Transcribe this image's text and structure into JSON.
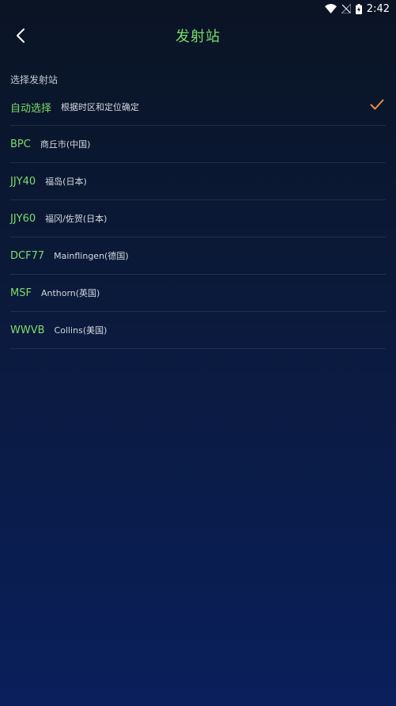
{
  "status_bar": {
    "time": "2:42"
  },
  "header": {
    "title": "发射站"
  },
  "section_label": "选择发射站",
  "stations": [
    {
      "code": "自动选择",
      "desc": "根据时区和定位确定",
      "selected": true
    },
    {
      "code": "BPC",
      "desc": "商丘市(中国)",
      "selected": false
    },
    {
      "code": "JJY40",
      "desc": "福岛(日本)",
      "selected": false
    },
    {
      "code": "JJY60",
      "desc": "福冈/佐贺(日本)",
      "selected": false
    },
    {
      "code": "DCF77",
      "desc": "Mainflingen(德国)",
      "selected": false
    },
    {
      "code": "MSF",
      "desc": "Anthorn(英国)",
      "selected": false
    },
    {
      "code": "WWVB",
      "desc": "Collins(美国)",
      "selected": false
    }
  ],
  "colors": {
    "accent_green": "#7ddc6a",
    "check_orange": "#e8913a"
  },
  "icons": {
    "back": "chevron-left-icon",
    "check": "check-icon",
    "wifi": "wifi-icon",
    "signal": "no-signal-icon",
    "battery": "battery-charging-icon"
  }
}
